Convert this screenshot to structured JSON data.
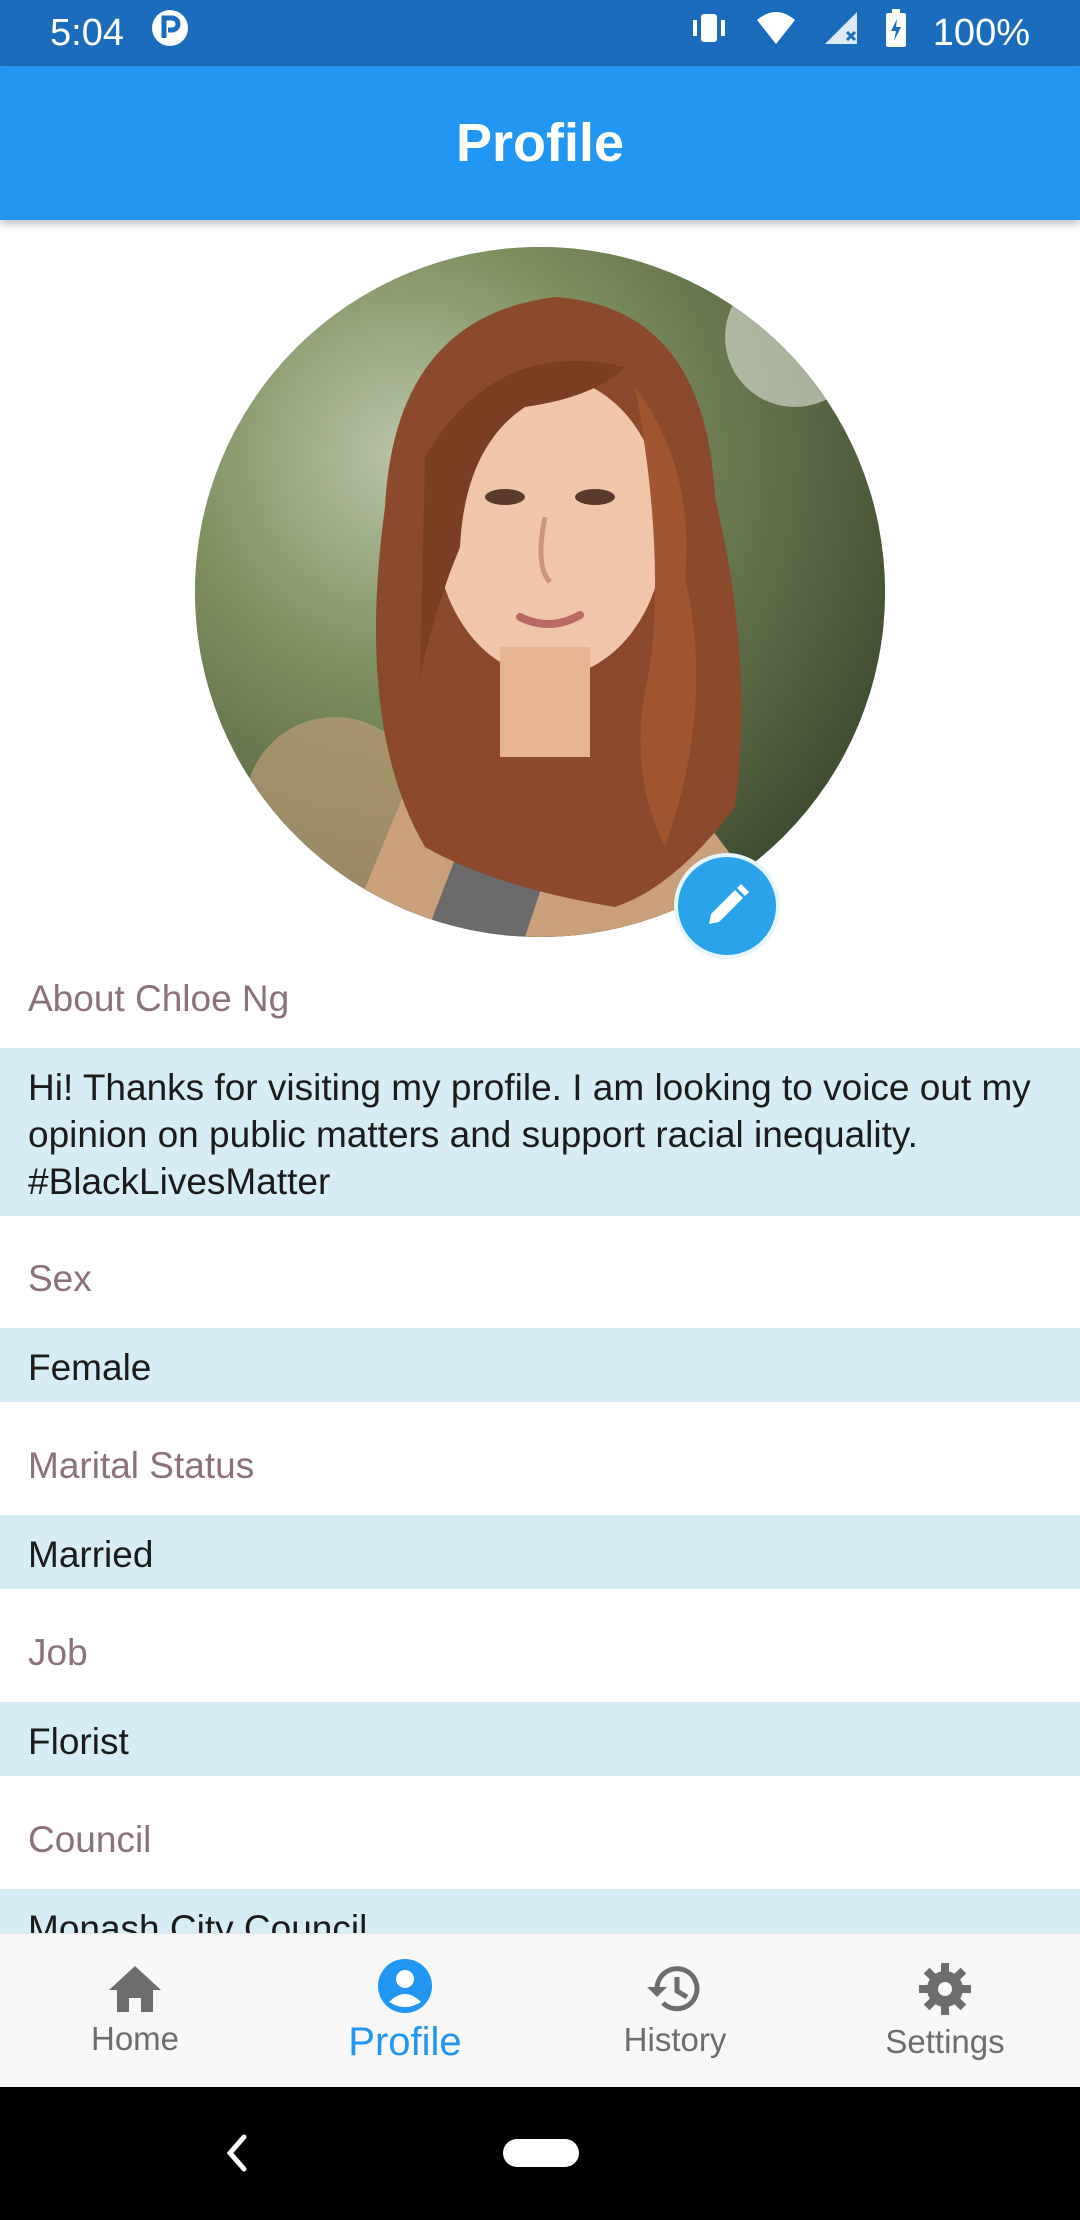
{
  "status_bar": {
    "time": "5:04",
    "battery": "100%",
    "icons": [
      "app-notification-icon",
      "vibrate-icon",
      "wifi-icon",
      "signal-icon",
      "battery-charging-icon"
    ]
  },
  "app_bar": {
    "title": "Profile"
  },
  "profile": {
    "avatar_icon": "avatar",
    "edit_icon": "pencil-icon",
    "sections": [
      {
        "label": "About Chloe Ng",
        "value": "Hi! Thanks for visiting my profile. I am looking to voice out my opinion on public matters and support racial inequality. #BlackLivesMatter"
      },
      {
        "label": "Sex",
        "value": "Female"
      },
      {
        "label": "Marital Status",
        "value": "Married"
      },
      {
        "label": "Job",
        "value": "Florist"
      },
      {
        "label": "Council",
        "value": "Monash City Council"
      }
    ]
  },
  "bottom_nav": {
    "items": [
      {
        "label": "Home",
        "icon": "home-icon"
      },
      {
        "label": "Profile",
        "icon": "person-icon"
      },
      {
        "label": "History",
        "icon": "history-icon"
      },
      {
        "label": "Settings",
        "icon": "gear-icon"
      }
    ],
    "active_color": "#2196f3"
  },
  "colors": {
    "app_bar": "#2196f3",
    "status_bar": "#1c6cbd",
    "value_bg": "#d6edf5",
    "label": "#8a7278"
  }
}
